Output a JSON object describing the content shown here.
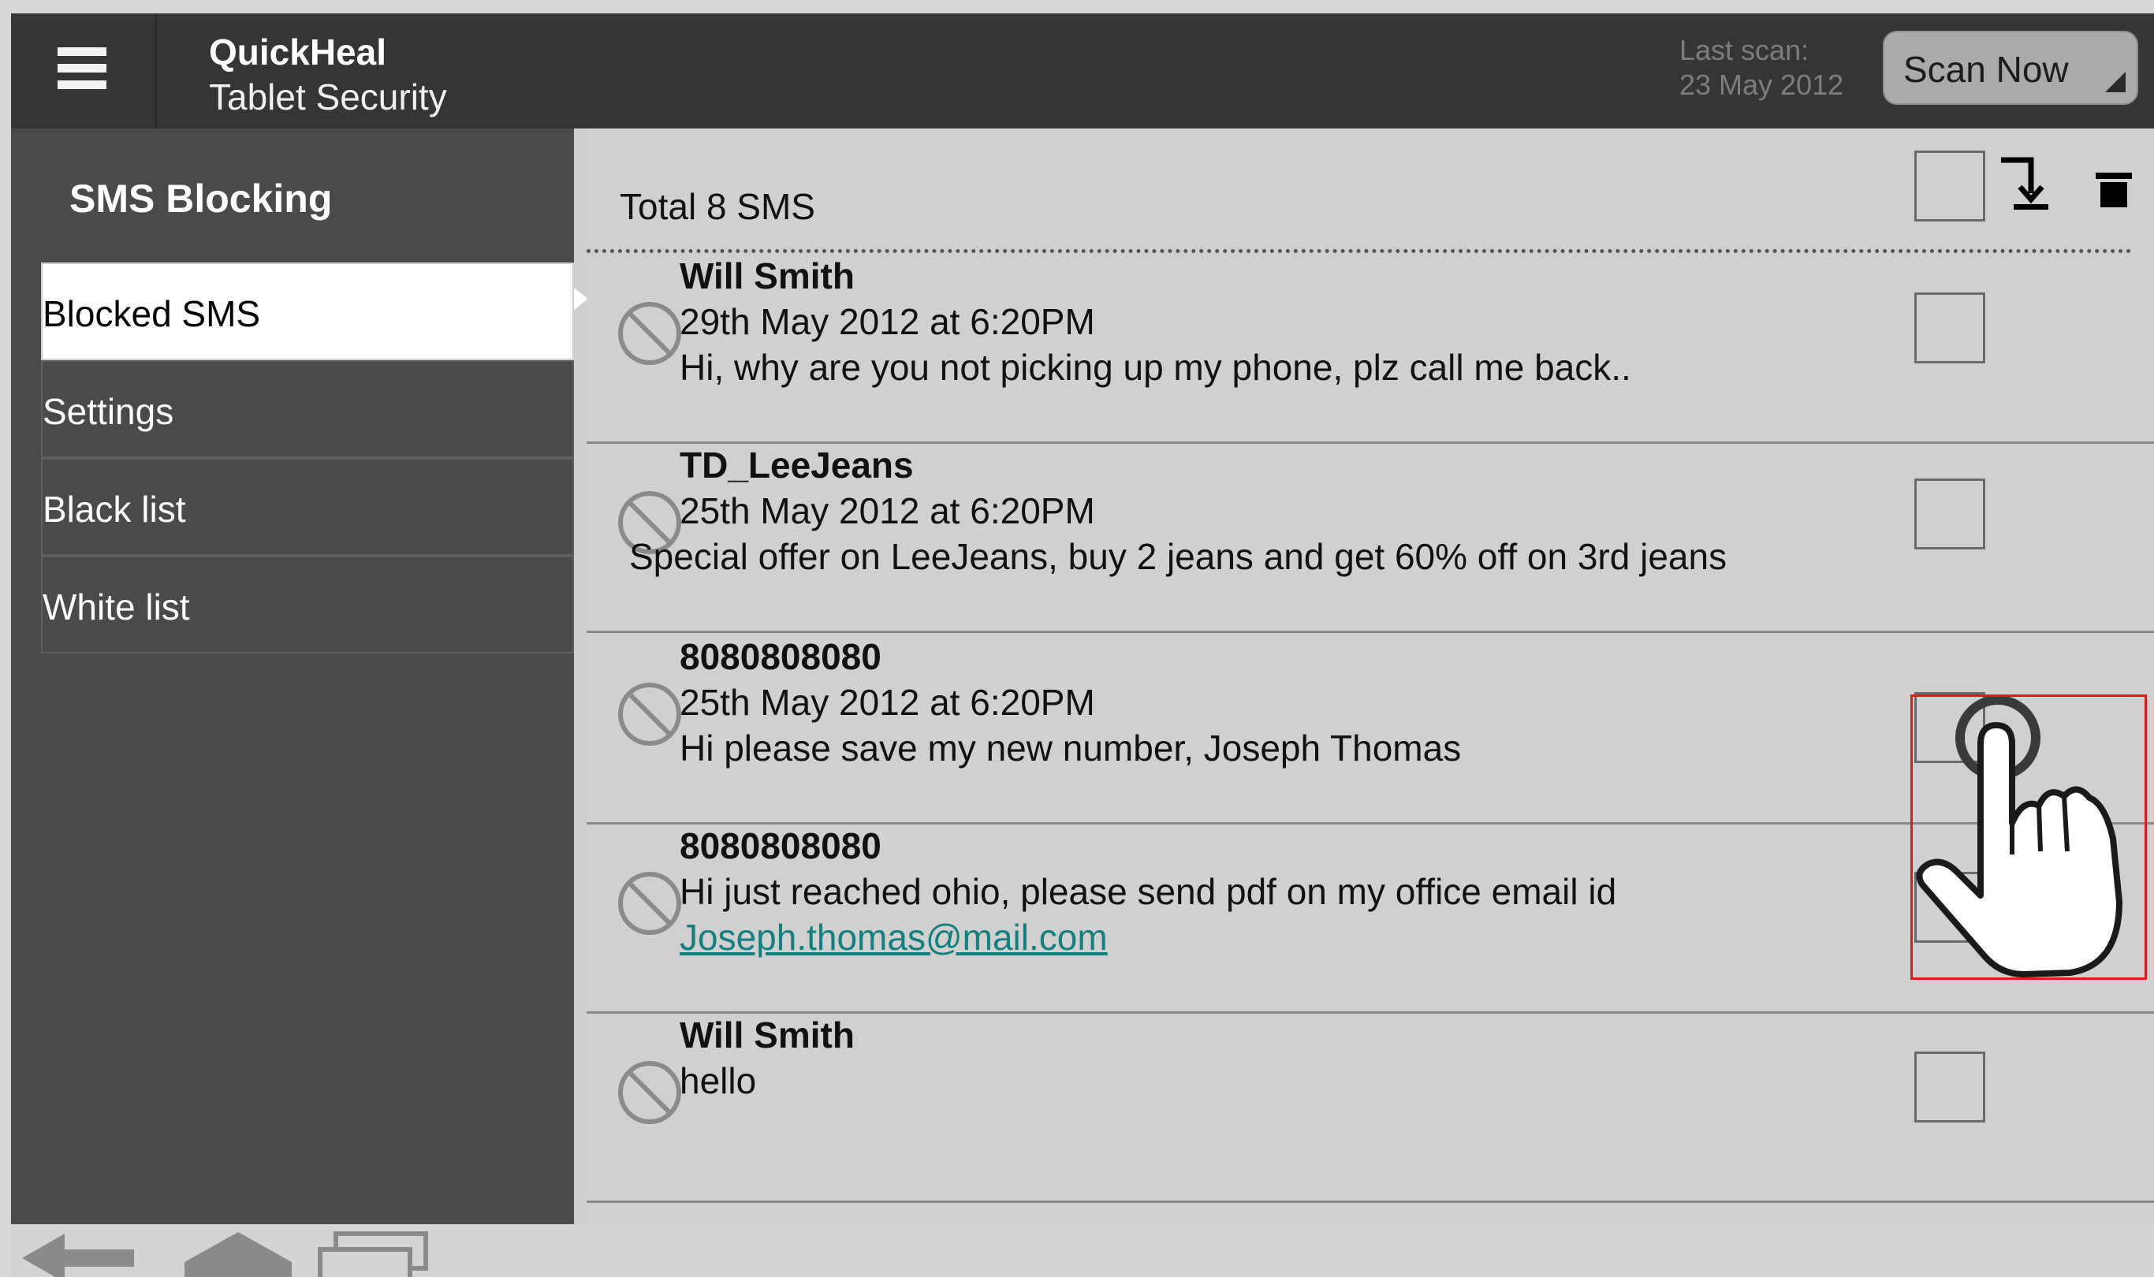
{
  "header": {
    "app_title": "QuickHeal",
    "app_subtitle": "Tablet Security",
    "last_scan_label": "Last scan:",
    "last_scan_date": "23 May 2012",
    "scan_button": "Scan Now"
  },
  "sidebar": {
    "title": "SMS Blocking",
    "items": [
      {
        "label": "Blocked SMS",
        "active": true
      },
      {
        "label": "Settings",
        "active": false
      },
      {
        "label": "Black list",
        "active": false
      },
      {
        "label": "White list",
        "active": false
      }
    ]
  },
  "main": {
    "total": "Total 8 SMS",
    "messages": [
      {
        "sender": "Will Smith",
        "date": "29th May 2012 at 6:20PM",
        "body": "Hi, why are you not picking up my phone, plz call me back.."
      },
      {
        "sender": "TD_LeeJeans",
        "date": "25th May 2012 at 6:20PM",
        "body": "Special offer on LeeJeans, buy 2 jeans and get 60% off on 3rd jeans"
      },
      {
        "sender": "8080808080",
        "date": "25th May 2012 at 6:20PM",
        "body": "Hi please save my new number, Joseph Thomas"
      },
      {
        "sender": "8080808080",
        "body": "Hi just reached ohio, please send pdf on my office email id",
        "link": "Joseph.thomas@mail.com"
      },
      {
        "sender": "Will Smith",
        "body": "hello"
      }
    ]
  },
  "icons": {
    "menu": "hamburger-icon",
    "import": "import-icon",
    "delete": "trash-icon",
    "blocked": "block-icon",
    "pointer": "hand-pointer-icon",
    "back": "back-arrow-icon",
    "home": "home-icon",
    "recent": "recent-apps-icon"
  },
  "colors": {
    "header_bg": "#353535",
    "sidebar_bg": "#4a4a4a",
    "list_bg": "#d0d0d0",
    "link": "#118080",
    "highlight": "#e01818"
  }
}
